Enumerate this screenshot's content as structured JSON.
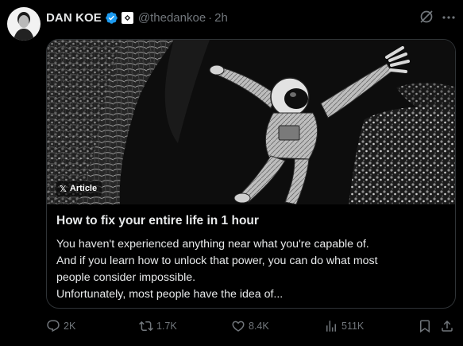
{
  "author": {
    "display_name": "DAN KOE",
    "handle": "@thedankoe",
    "separator": "·",
    "time": "2h"
  },
  "icons": {
    "verified": "verified-badge-icon",
    "affiliate": "affiliate-badge-icon",
    "grok": "grok-icon",
    "more": "more-icon",
    "reply": "reply-icon",
    "repost": "repost-icon",
    "like": "like-icon",
    "views": "views-icon",
    "bookmark": "bookmark-icon",
    "share": "share-icon"
  },
  "colors": {
    "verified_blue": "#1d9bf0",
    "muted_text": "#71767b",
    "border": "#2f3336"
  },
  "card": {
    "badge": "Article",
    "badge_mark": "𝕏",
    "title": "How to fix your entire life in 1 hour",
    "body": [
      "You haven't experienced anything near what you're capable of.",
      "And if you learn how to unlock that power, you can do what most",
      "people consider impossible.",
      "Unfortunately, most people have the idea of..."
    ]
  },
  "actions": {
    "replies": "2K",
    "reposts": "1.7K",
    "likes": "8.4K",
    "views": "511K"
  }
}
